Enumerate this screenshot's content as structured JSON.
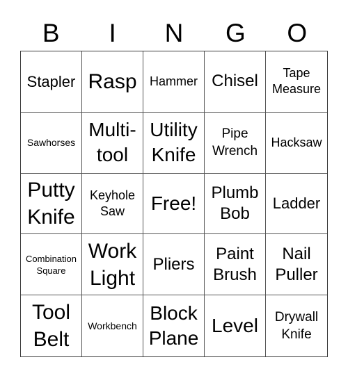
{
  "card": {
    "header": [
      "B",
      "I",
      "N",
      "G",
      "O"
    ],
    "rows": [
      [
        "Stapler",
        "Rasp",
        "Hammer",
        "Chisel",
        "Tape Measure"
      ],
      [
        "Sawhorses",
        "Multi-tool",
        "Utility Knife",
        "Pipe Wrench",
        "Hacksaw"
      ],
      [
        "Putty Knife",
        "Keyhole Saw",
        "Free!",
        "Plumb Bob",
        "Ladder"
      ],
      [
        "Combination Square",
        "Work Light",
        "Pliers",
        "Paint Brush",
        "Nail Puller"
      ],
      [
        "Tool Belt",
        "Workbench",
        "Block Plane",
        "Level",
        "Drywall Knife"
      ]
    ],
    "free_space": "Free!",
    "line_color": "#555555",
    "background": "#ffffff",
    "text_color": "#000000"
  }
}
